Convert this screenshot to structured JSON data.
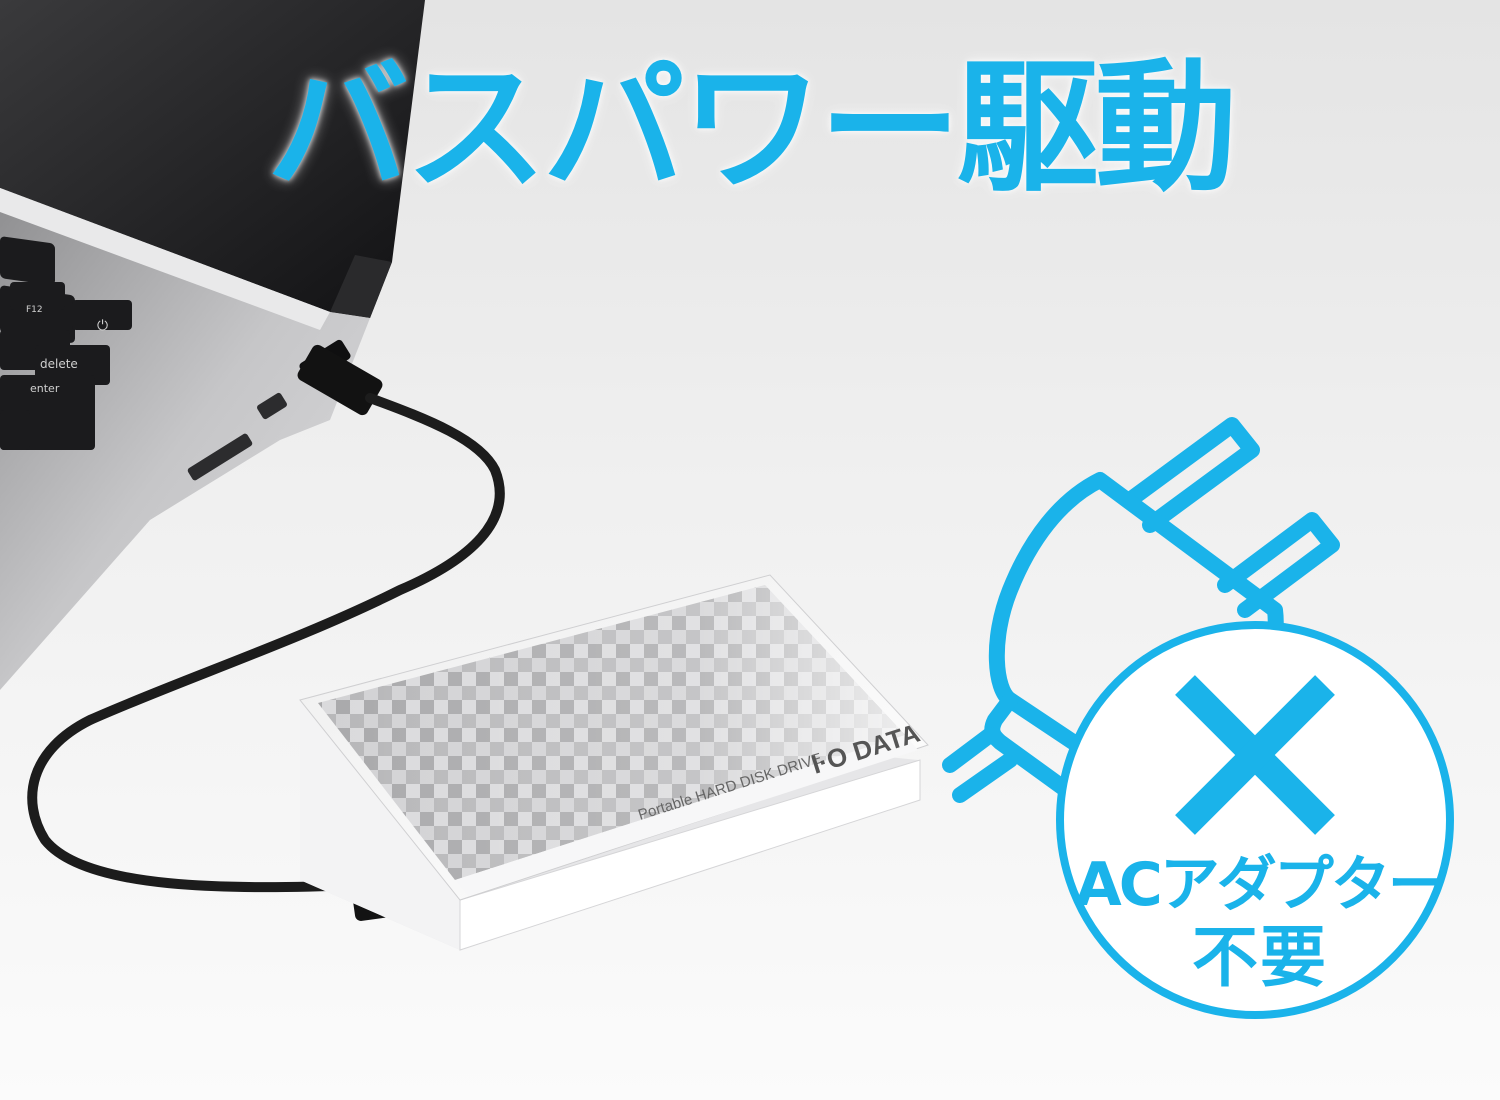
{
  "headline": "バスパワー駆動",
  "badge": {
    "line1": "ACアダプター",
    "line2": "不要"
  },
  "laptop": {
    "keys": {
      "f12": "F12",
      "delete": "delete",
      "enter": "enter"
    }
  },
  "drive": {
    "product_text": "Portable HARD DISK DRIVE",
    "brand": "I·O DATA"
  },
  "colors": {
    "accent": "#1ab3ea",
    "background": "#f4f4f4",
    "cable": "#1c1c1c",
    "laptop_body": "#b9b9bb"
  }
}
